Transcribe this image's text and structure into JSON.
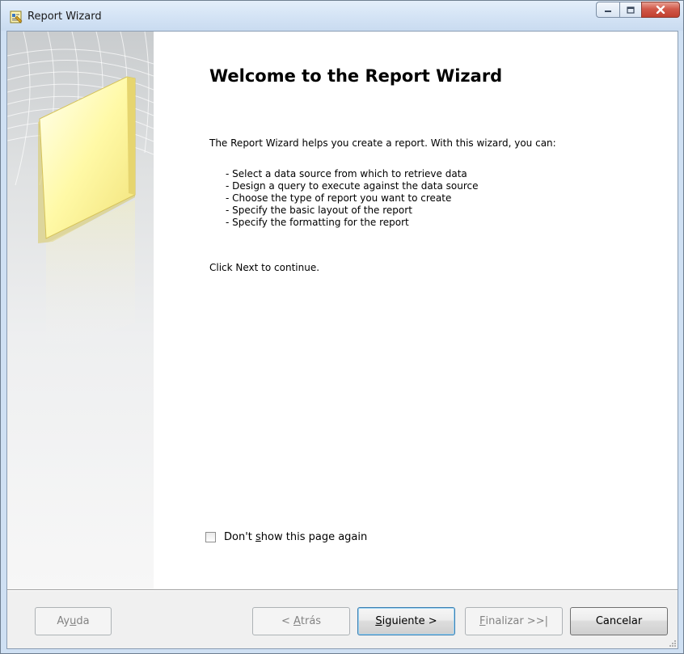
{
  "window": {
    "title": "Report Wizard",
    "icons": [
      "report-wizard-app-icon",
      "minimize-icon",
      "maximize-icon",
      "close-icon"
    ]
  },
  "content": {
    "heading": "Welcome to the Report Wizard",
    "intro": "The Report Wizard helps you create a report. With this wizard, you can:",
    "bullets": [
      "- Select a data source from which to retrieve data",
      "- Design a query to execute against the data source",
      "- Choose the type of report you want to create",
      "- Specify the basic layout of the report",
      "- Specify the formatting for the report"
    ],
    "click_next": "Click Next to continue."
  },
  "checkbox": {
    "label_prefix": "Don't ",
    "label_accel": "s",
    "label_suffix": "how this page again",
    "checked": false
  },
  "buttons": {
    "help": {
      "prefix": "Ay",
      "accel": "u",
      "suffix": "da",
      "enabled": false
    },
    "back": {
      "prefix": "< ",
      "accel": "A",
      "suffix": "trás",
      "enabled": false
    },
    "next": {
      "prefix": "",
      "accel": "S",
      "suffix": "iguiente >",
      "enabled": true
    },
    "finish": {
      "prefix": "",
      "accel": "F",
      "suffix": "inalizar >>|",
      "enabled": false
    },
    "cancel": {
      "label": "Cancelar",
      "enabled": true
    }
  },
  "colors": {
    "banner_panel": "#ffffb0",
    "close_button": "#c9493a"
  }
}
